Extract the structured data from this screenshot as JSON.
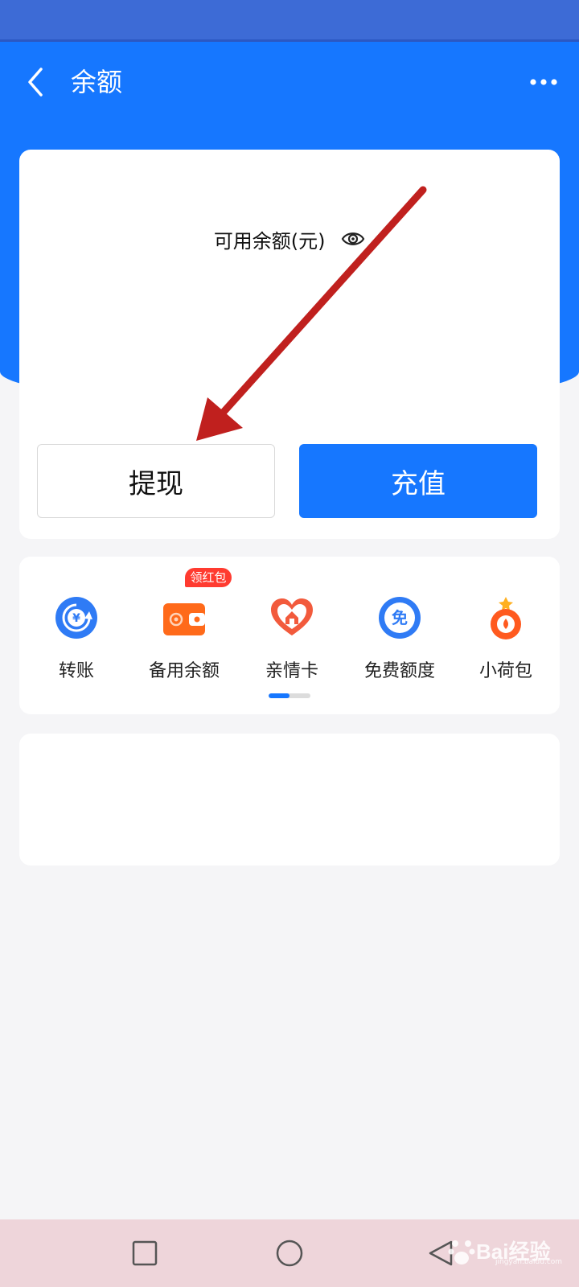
{
  "header": {
    "title": "余额",
    "back_icon": "chevron-left-icon",
    "more_icon": "more-dots-icon"
  },
  "balance": {
    "label": "可用余额(元)",
    "visibility_icon": "eye-icon"
  },
  "actions": {
    "withdraw_label": "提现",
    "recharge_label": "充值"
  },
  "services": {
    "items": [
      {
        "label": "转账",
        "icon": "transfer-yuan-icon",
        "color": "#2f7bf5"
      },
      {
        "label": "备用余额",
        "icon": "wallet-icon",
        "color": "#ff6a1a",
        "badge": "领红包"
      },
      {
        "label": "亲情卡",
        "icon": "heart-home-icon",
        "color": "#f25a3c"
      },
      {
        "label": "免费额度",
        "icon": "free-quota-icon",
        "color": "#2f7bf5"
      },
      {
        "label": "小荷包",
        "icon": "purse-icon",
        "color": "#ff5a1f"
      }
    ],
    "scroll_progress": 0.5
  },
  "colors": {
    "primary": "#1677ff",
    "status_bar": "#3d6bd6",
    "annotation_arrow": "#c0201e",
    "badge": "#ff3b30"
  },
  "system_nav": {
    "recent_icon": "square-icon",
    "home_icon": "circle-icon",
    "back_icon": "triangle-back-icon"
  },
  "watermark": {
    "text": "Bai经验",
    "sub": "jingyan.baidu.com"
  }
}
